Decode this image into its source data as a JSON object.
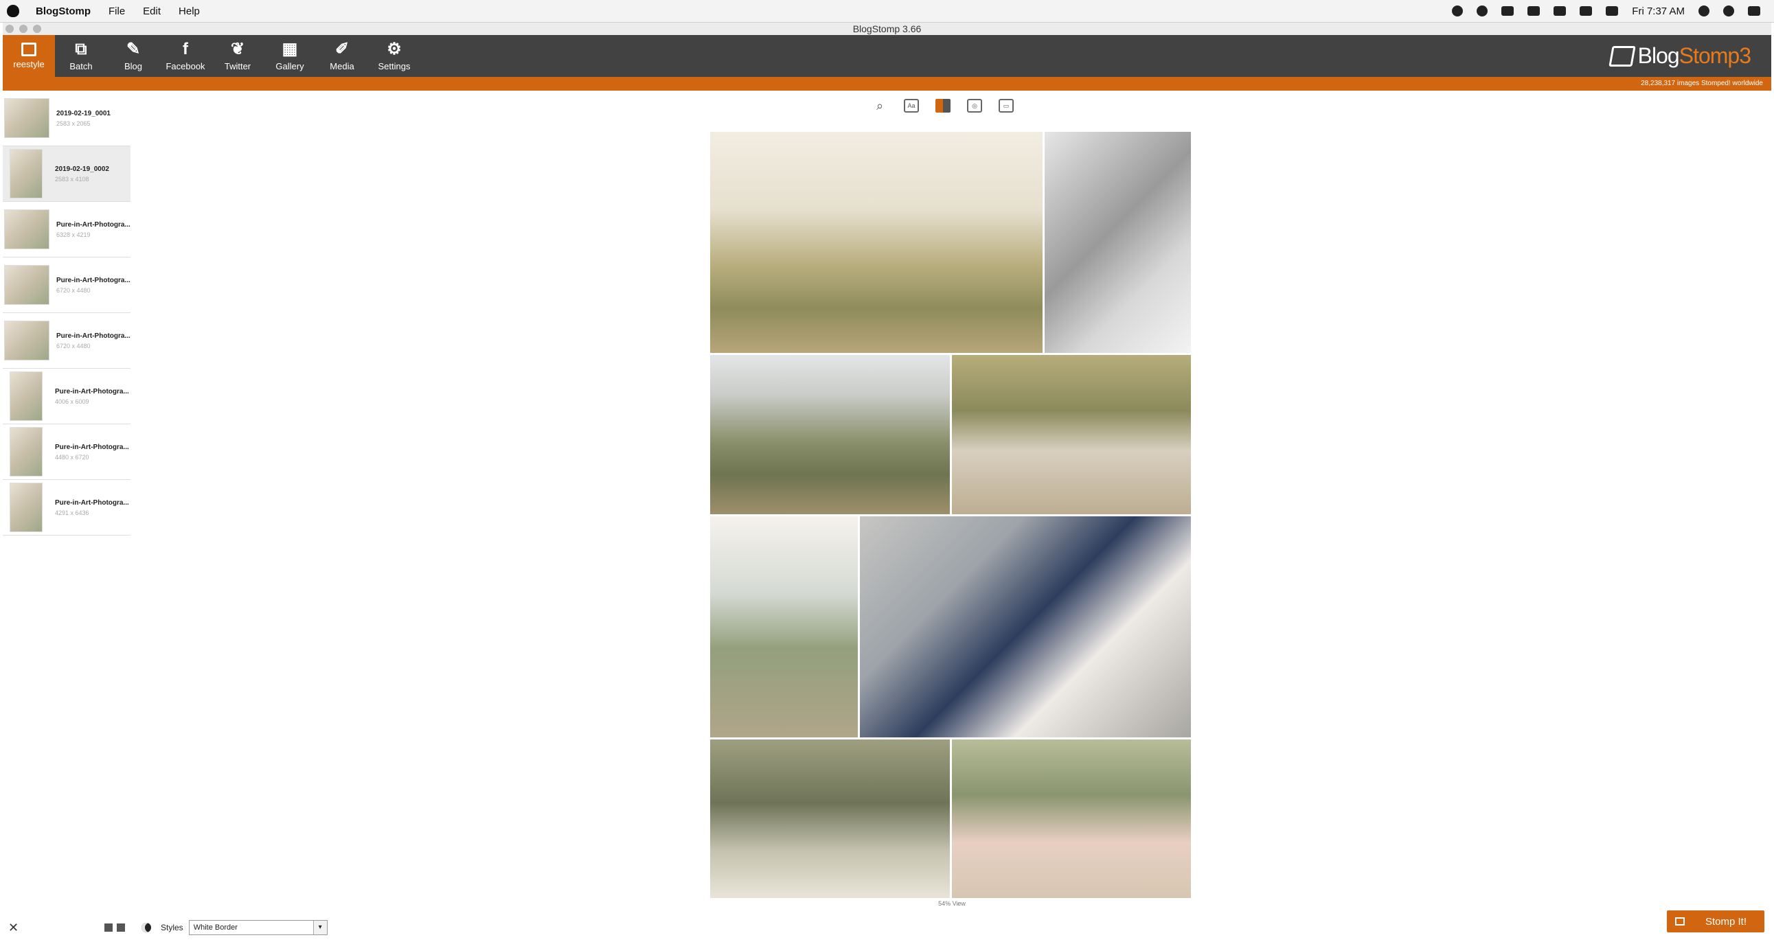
{
  "menubar": {
    "app_name": "BlogStomp",
    "items": [
      "File",
      "Edit",
      "Help"
    ],
    "clock": "Fri 7:37 AM"
  },
  "window": {
    "title": "BlogStomp 3.66"
  },
  "toolbar": {
    "items": [
      {
        "label": "reestyle",
        "icon": "freestyle-icon",
        "active": true
      },
      {
        "label": "Batch",
        "icon": "batch-icon"
      },
      {
        "label": "Blog",
        "icon": "blog-icon"
      },
      {
        "label": "Facebook",
        "icon": "facebook-icon"
      },
      {
        "label": "Twitter",
        "icon": "twitter-icon"
      },
      {
        "label": "Gallery",
        "icon": "gallery-icon"
      },
      {
        "label": "Media",
        "icon": "media-icon"
      },
      {
        "label": "Settings",
        "icon": "settings-icon"
      }
    ],
    "logo_prefix": "Blog",
    "logo_suffix": "Stomp3"
  },
  "stats": "28,238,317 images Stomped! worldwide",
  "files": [
    {
      "name": "2019-02-19_0001",
      "dims": "2583 x 2065"
    },
    {
      "name": "2019-02-19_0002",
      "dims": "2583 x 4108"
    },
    {
      "name": "Pure-in-Art-Photogra...",
      "dims": "6328 x 4219"
    },
    {
      "name": "Pure-in-Art-Photogra...",
      "dims": "6720 x 4480"
    },
    {
      "name": "Pure-in-Art-Photogra...",
      "dims": "6720 x 4480"
    },
    {
      "name": "Pure-in-Art-Photogra...",
      "dims": "4006 x 6009"
    },
    {
      "name": "Pure-in-Art-Photogra...",
      "dims": "4480 x 6720"
    },
    {
      "name": "Pure-in-Art-Photogra...",
      "dims": "4291 x 6436"
    }
  ],
  "preview": {
    "zoom": "54% View"
  },
  "bottom": {
    "styles_label": "Styles",
    "styles_value": "White Border",
    "stomp_label": "Stomp It!"
  }
}
